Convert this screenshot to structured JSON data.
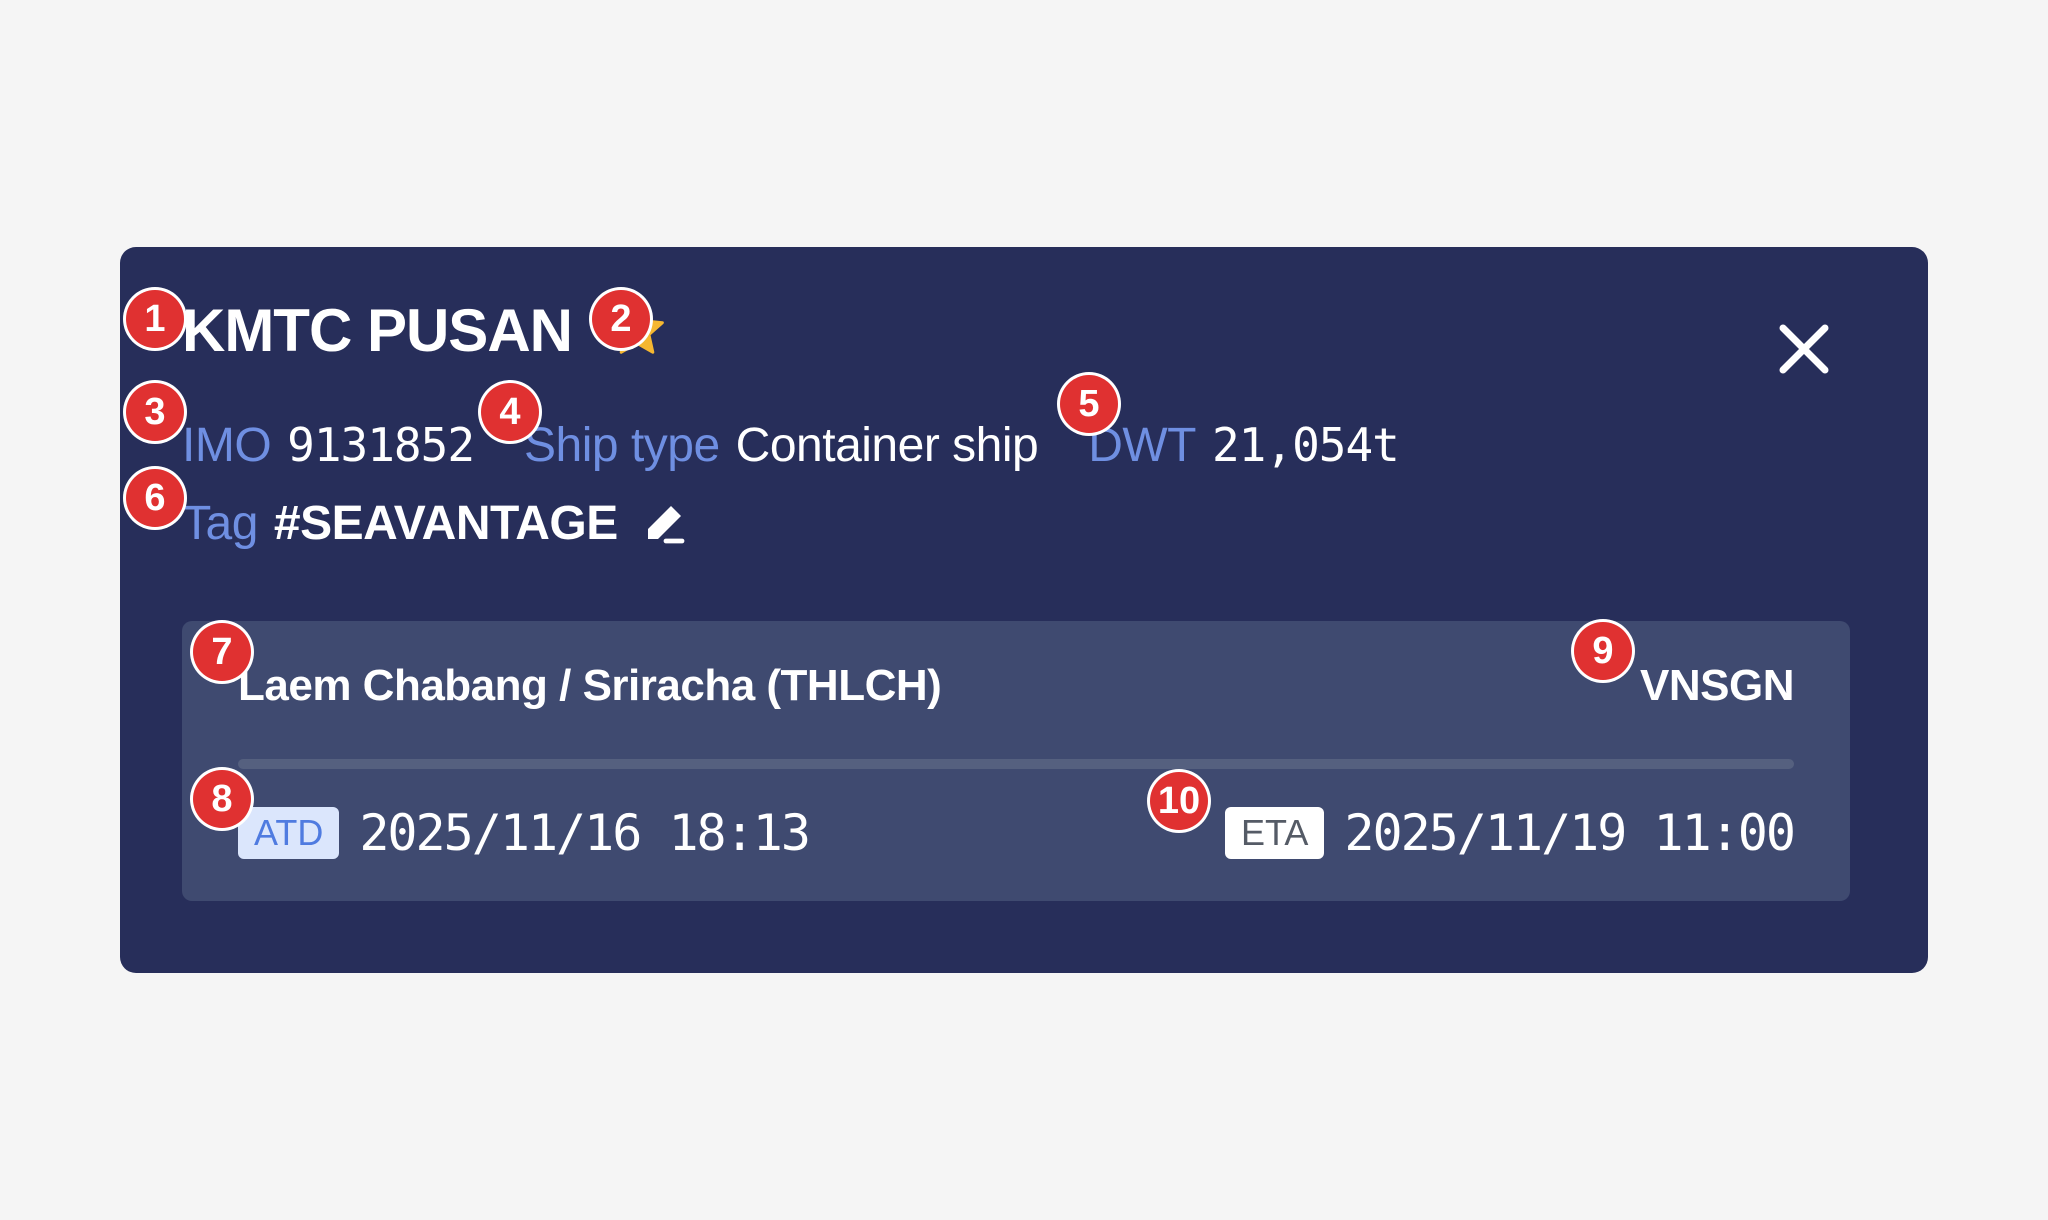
{
  "vessel": {
    "name": "KMTC PUSAN",
    "favorite_icon": "star-icon",
    "close_icon": "close-icon"
  },
  "meta": {
    "imo_label": "IMO",
    "imo_value": "9131852",
    "ship_type_label": "Ship type",
    "ship_type_value": "Container ship",
    "dwt_label": "DWT",
    "dwt_value": "21,054t"
  },
  "tag": {
    "label": "Tag",
    "value": "#SEAVANTAGE",
    "edit_icon": "pencil-icon"
  },
  "route": {
    "origin": "Laem Chabang / Sriracha (THLCH)",
    "destination": "VNSGN",
    "atd_label": "ATD",
    "atd_value": "2025/11/16 18:13",
    "eta_label": "ETA",
    "eta_value": "2025/11/19 11:00"
  },
  "annotations": [
    "1",
    "2",
    "3",
    "4",
    "5",
    "6",
    "7",
    "8",
    "9",
    "10"
  ],
  "colors": {
    "card_bg": "#272e5a",
    "route_bg": "#3f4a70",
    "label_blue": "#6f8fe2",
    "star": "#f5b731",
    "marker_red": "#e03131"
  }
}
